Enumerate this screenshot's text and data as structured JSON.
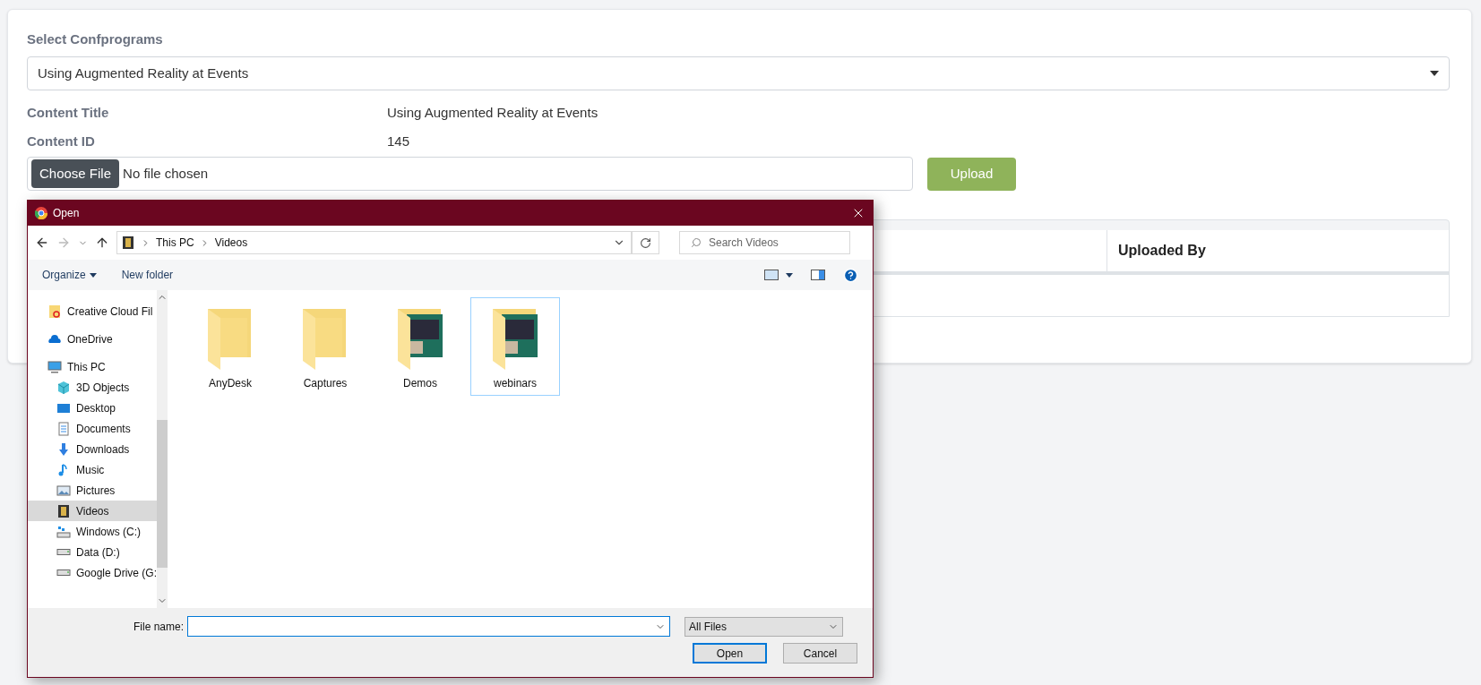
{
  "form": {
    "select_label": "Select Confprograms",
    "select_value": "Using Augmented Reality at Events",
    "fields": [
      {
        "label": "Content Title",
        "value": "Using Augmented Reality at Events"
      },
      {
        "label": "Content ID",
        "value": "145"
      }
    ],
    "file_button": "Choose File",
    "file_status": "No file chosen",
    "upload_button": "Upload"
  },
  "table": {
    "columns": [
      "Uploaded By"
    ]
  },
  "dialog": {
    "title": "Open",
    "address": [
      "This PC",
      "Videos"
    ],
    "search": {
      "placeholder": "Search Videos"
    },
    "commands": [
      {
        "label": "Organize",
        "menu": true
      },
      {
        "label": "New folder",
        "menu": false
      }
    ],
    "sidebar": [
      {
        "label": "Creative Cloud Fil",
        "kind": "cloud-folder",
        "selected": false
      },
      {
        "label": "OneDrive",
        "kind": "cloud",
        "selected": false
      },
      {
        "label": "This PC",
        "kind": "computer",
        "selected": false,
        "children": [
          {
            "label": "3D Objects",
            "kind": "cube",
            "selected": false
          },
          {
            "label": "Desktop",
            "kind": "desktop",
            "selected": false
          },
          {
            "label": "Documents",
            "kind": "document",
            "selected": false
          },
          {
            "label": "Downloads",
            "kind": "download",
            "selected": false
          },
          {
            "label": "Music",
            "kind": "music",
            "selected": false
          },
          {
            "label": "Pictures",
            "kind": "picture",
            "selected": false
          },
          {
            "label": "Videos",
            "kind": "video",
            "selected": true
          },
          {
            "label": "Windows (C:)",
            "kind": "system-drive",
            "selected": false
          },
          {
            "label": "Data (D:)",
            "kind": "drive",
            "selected": false
          },
          {
            "label": "Google Drive (G:",
            "kind": "drive",
            "selected": false
          }
        ]
      }
    ],
    "folders": [
      {
        "name": "AnyDesk",
        "kind": "plain",
        "selected": false
      },
      {
        "name": "Captures",
        "kind": "plain",
        "selected": false
      },
      {
        "name": "Demos",
        "kind": "preview",
        "selected": false
      },
      {
        "name": "webinars",
        "kind": "preview",
        "selected": true
      }
    ],
    "file_name_label": "File name:",
    "file_type": "All Files",
    "buttons": [
      {
        "label": "Open",
        "default": true
      },
      {
        "label": "Cancel",
        "default": false
      }
    ]
  }
}
